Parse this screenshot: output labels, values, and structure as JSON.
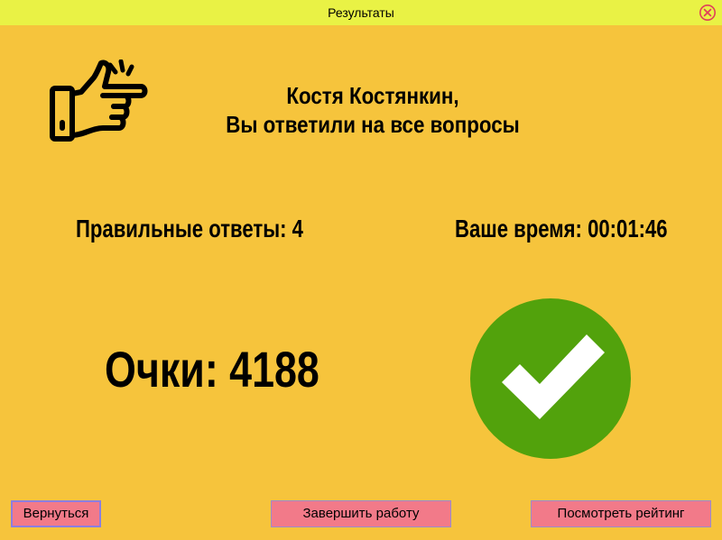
{
  "window": {
    "title": "Результаты",
    "close_icon": "close-circle-icon",
    "titlebar_color": "#e9f245",
    "background_color": "#f6c43c"
  },
  "message": {
    "user_name_line": "Костя Костянкин,",
    "status_line": "Вы ответили на все вопросы",
    "icon": "thumbs-up-pointing-icon"
  },
  "stats": {
    "correct_answers": "Правильные ответы: 4",
    "time": "Ваше время: 00:01:46"
  },
  "score": {
    "text": "Очки: 4188"
  },
  "result_icon": {
    "icon": "checkmark-circle-icon",
    "color": "#52a20c"
  },
  "buttons": {
    "back": "Вернуться",
    "finish": "Завершить работу",
    "rating": "Посмотреть рейтинг",
    "color": "#f27a89"
  }
}
